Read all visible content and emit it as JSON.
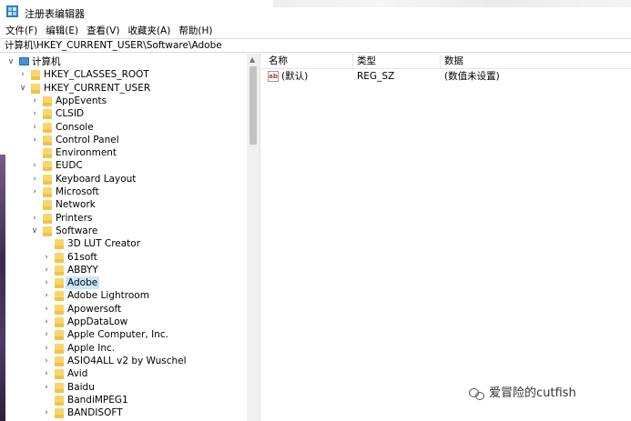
{
  "window": {
    "title": "注册表编辑器"
  },
  "menu": [
    "文件(F)",
    "编辑(E)",
    "查看(V)",
    "收藏夹(A)",
    "帮助(H)"
  ],
  "address": "计算机\\HKEY_CURRENT_USER\\Software\\Adobe",
  "tree": [
    {
      "label": "计算机",
      "level": 0,
      "chevron": "expanded",
      "icon": "computer"
    },
    {
      "label": "HKEY_CLASSES_ROOT",
      "level": 1,
      "chevron": "collapsed",
      "icon": "folder"
    },
    {
      "label": "HKEY_CURRENT_USER",
      "level": 1,
      "chevron": "expanded",
      "icon": "folder"
    },
    {
      "label": "AppEvents",
      "level": 2,
      "chevron": "collapsed",
      "icon": "folder"
    },
    {
      "label": "CLSID",
      "level": 2,
      "chevron": "collapsed",
      "icon": "folder"
    },
    {
      "label": "Console",
      "level": 2,
      "chevron": "collapsed",
      "icon": "folder"
    },
    {
      "label": "Control Panel",
      "level": 2,
      "chevron": "collapsed",
      "icon": "folder"
    },
    {
      "label": "Environment",
      "level": 2,
      "chevron": "none",
      "icon": "folder"
    },
    {
      "label": "EUDC",
      "level": 2,
      "chevron": "collapsed",
      "icon": "folder"
    },
    {
      "label": "Keyboard Layout",
      "level": 2,
      "chevron": "collapsed",
      "icon": "folder"
    },
    {
      "label": "Microsoft",
      "level": 2,
      "chevron": "collapsed",
      "icon": "folder"
    },
    {
      "label": "Network",
      "level": 2,
      "chevron": "none",
      "icon": "folder"
    },
    {
      "label": "Printers",
      "level": 2,
      "chevron": "collapsed",
      "icon": "folder"
    },
    {
      "label": "Software",
      "level": 2,
      "chevron": "expanded",
      "icon": "folder"
    },
    {
      "label": "3D LUT Creator",
      "level": 3,
      "chevron": "none",
      "icon": "folder"
    },
    {
      "label": "61soft",
      "level": 3,
      "chevron": "collapsed",
      "icon": "folder"
    },
    {
      "label": "ABBYY",
      "level": 3,
      "chevron": "collapsed",
      "icon": "folder"
    },
    {
      "label": "Adobe",
      "level": 3,
      "chevron": "collapsed",
      "icon": "folder",
      "selected": true
    },
    {
      "label": "Adobe Lightroom",
      "level": 3,
      "chevron": "collapsed",
      "icon": "folder"
    },
    {
      "label": "Apowersoft",
      "level": 3,
      "chevron": "collapsed",
      "icon": "folder"
    },
    {
      "label": "AppDataLow",
      "level": 3,
      "chevron": "collapsed",
      "icon": "folder"
    },
    {
      "label": "Apple Computer, Inc.",
      "level": 3,
      "chevron": "collapsed",
      "icon": "folder"
    },
    {
      "label": "Apple Inc.",
      "level": 3,
      "chevron": "collapsed",
      "icon": "folder"
    },
    {
      "label": "ASIO4ALL v2 by Wuschel",
      "level": 3,
      "chevron": "collapsed",
      "icon": "folder"
    },
    {
      "label": "Avid",
      "level": 3,
      "chevron": "collapsed",
      "icon": "folder"
    },
    {
      "label": "Baidu",
      "level": 3,
      "chevron": "collapsed",
      "icon": "folder"
    },
    {
      "label": "BandiMPEG1",
      "level": 3,
      "chevron": "none",
      "icon": "folder"
    },
    {
      "label": "BANDISOFT",
      "level": 3,
      "chevron": "collapsed",
      "icon": "folder"
    },
    {
      "label": "",
      "level": 3,
      "chevron": "collapsed",
      "icon": "folder"
    }
  ],
  "list": {
    "headers": {
      "name": "名称",
      "type": "类型",
      "data": "数据"
    },
    "rows": [
      {
        "icon": "reg-string-icon",
        "name": "(默认)",
        "type": "REG_SZ",
        "data": "(数值未设置)"
      }
    ]
  },
  "watermark": "爱冒险的cutfish"
}
